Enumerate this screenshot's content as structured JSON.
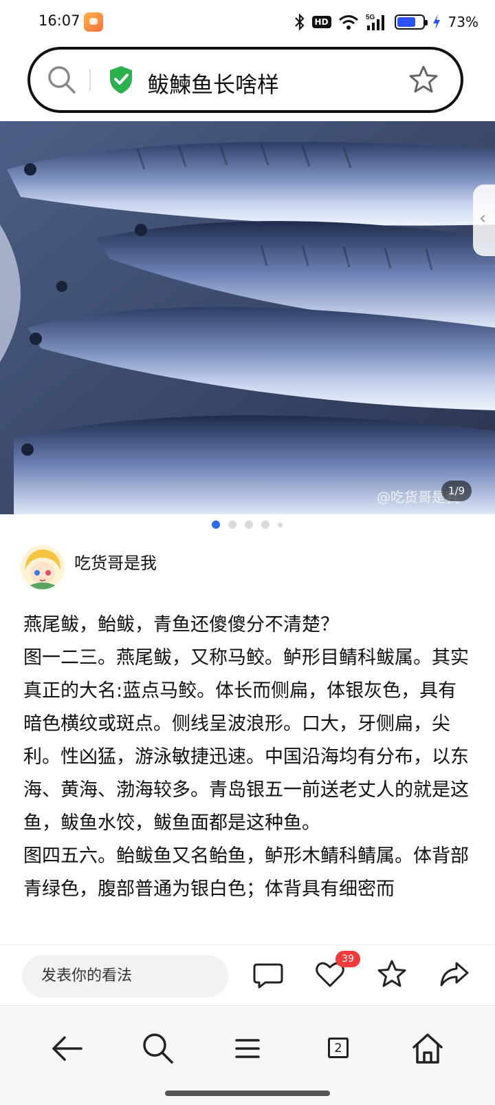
{
  "status_bar": {
    "time": "16:07",
    "icons": [
      "app-icon",
      "bluetooth-icon",
      "hd-icon",
      "wifi-icon",
      "5g-signal-icon",
      "battery-icon",
      "charging-icon"
    ],
    "hd_label": "HD",
    "battery_level": 0.73,
    "battery_text": "73%"
  },
  "search": {
    "query": "鲅鰊鱼长啥样",
    "icons": [
      "search-icon",
      "shield-check-icon",
      "star-outline-icon"
    ],
    "shield_color": "#2bb24c"
  },
  "carousel": {
    "watermark": "@吃货哥是我",
    "page_indicator": "1/9",
    "dots_total": 5,
    "active_dot": 1,
    "active_color": "#2a6df4"
  },
  "author": {
    "name": "吃货哥是我",
    "avatar_icon": "avatar-cartoon-icon"
  },
  "article": {
    "paragraphs": [
      "燕尾鲅，鲐鲅，青鱼还傻傻分不清楚？",
      "图一二三。燕尾鲅，又称马鲛。鲈形目鲭科鲅属。其实真正的大名:蓝点马鲛。体长而侧扁，体银灰色，具有暗色横纹或斑点。侧线呈波浪形。口大，牙侧扁，尖利。性凶猛，游泳敏捷迅速。中国沿海均有分布，以东海、黄海、渤海较多。青岛银五一前送老丈人的就是这鱼，鲅鱼水饺，鲅鱼面都是这种鱼。",
      "图四五六。鲐鲅鱼又名鲐鱼，鲈形木鲭科鲭属。体背部青绿色，腹部普通为银白色；体背具有细密而"
    ]
  },
  "comment_bar": {
    "placeholder": "发表你的看法",
    "like_count": "39",
    "icons": [
      "comment-icon",
      "heart-icon",
      "star-icon",
      "share-icon"
    ],
    "badge_color": "#f23b3b"
  },
  "bottom_nav": {
    "icons": [
      "back-arrow-icon",
      "search-icon",
      "menu-icon",
      "tabs-icon",
      "home-icon"
    ],
    "tab_count": "2"
  }
}
